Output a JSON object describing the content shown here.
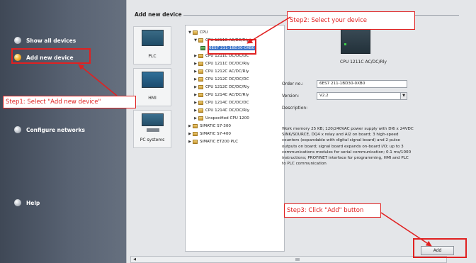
{
  "sidebar": {
    "items": [
      {
        "label": "Show all devices",
        "icon": "bullet-icon",
        "active": false
      },
      {
        "label": "Add new device",
        "icon": "bullet-icon",
        "active": true
      },
      {
        "label": "Configure networks",
        "icon": "bullet-icon",
        "active": false
      },
      {
        "label": "Help",
        "icon": "bullet-icon",
        "active": false
      }
    ]
  },
  "panel": {
    "title": "Add new device",
    "device_types": [
      {
        "label": "PLC"
      },
      {
        "label": "HMI"
      },
      {
        "label": "PC systems"
      }
    ]
  },
  "tree": {
    "items": [
      {
        "label": "CPU"
      },
      {
        "label": "CPU 1211C AC/DC/Rly"
      },
      {
        "label": "6ES7 211-1BD30-0XB0"
      },
      {
        "label": "CPU 1211C DC/DC/DC"
      },
      {
        "label": "CPU 1211C DC/DC/Rly"
      },
      {
        "label": "CPU 1212C AC/DC/Rly"
      },
      {
        "label": "CPU 1212C DC/DC/DC"
      },
      {
        "label": "CPU 1212C DC/DC/Rly"
      },
      {
        "label": "CPU 1214C AC/DC/Rly"
      },
      {
        "label": "CPU 1214C DC/DC/DC"
      },
      {
        "label": "CPU 1214C DC/DC/Rly"
      },
      {
        "label": "Unspecified CPU 1200"
      },
      {
        "label": "SIMATIC S7-300"
      },
      {
        "label": "SIMATIC S7-400"
      },
      {
        "label": "SIMATIC ET200 PLC"
      }
    ]
  },
  "details": {
    "device_name": "CPU 1211C AC/DC/Rly",
    "order_label": "Order no.:",
    "order_value": "6ES7 211-1BD30-0XB0",
    "version_label": "Version:",
    "version_value": "V2.2",
    "description_label": "Description:",
    "description": "Work memory 25 KB; 120/240VAC power supply with DI6 x 24VDC SINK/SOURCE, DQ4 x relay and AI2 on board; 3 high-speed counters (expandable with digital signal board) and 2 pulse outputs on board; signal board expands on-board I/O; up to 3 communications modules for serial communication; 0.1 ms/1000 instructions; PROFINET interface for programming, HMI and PLC to PLC communication"
  },
  "footer": {
    "add_label": "Add"
  },
  "annotations": {
    "step1": "Step1: Select \"Add new device\"",
    "step2": "Step2: Select your device",
    "step3": "Step3: Click \"Add\" button",
    "color": "#e02121"
  }
}
